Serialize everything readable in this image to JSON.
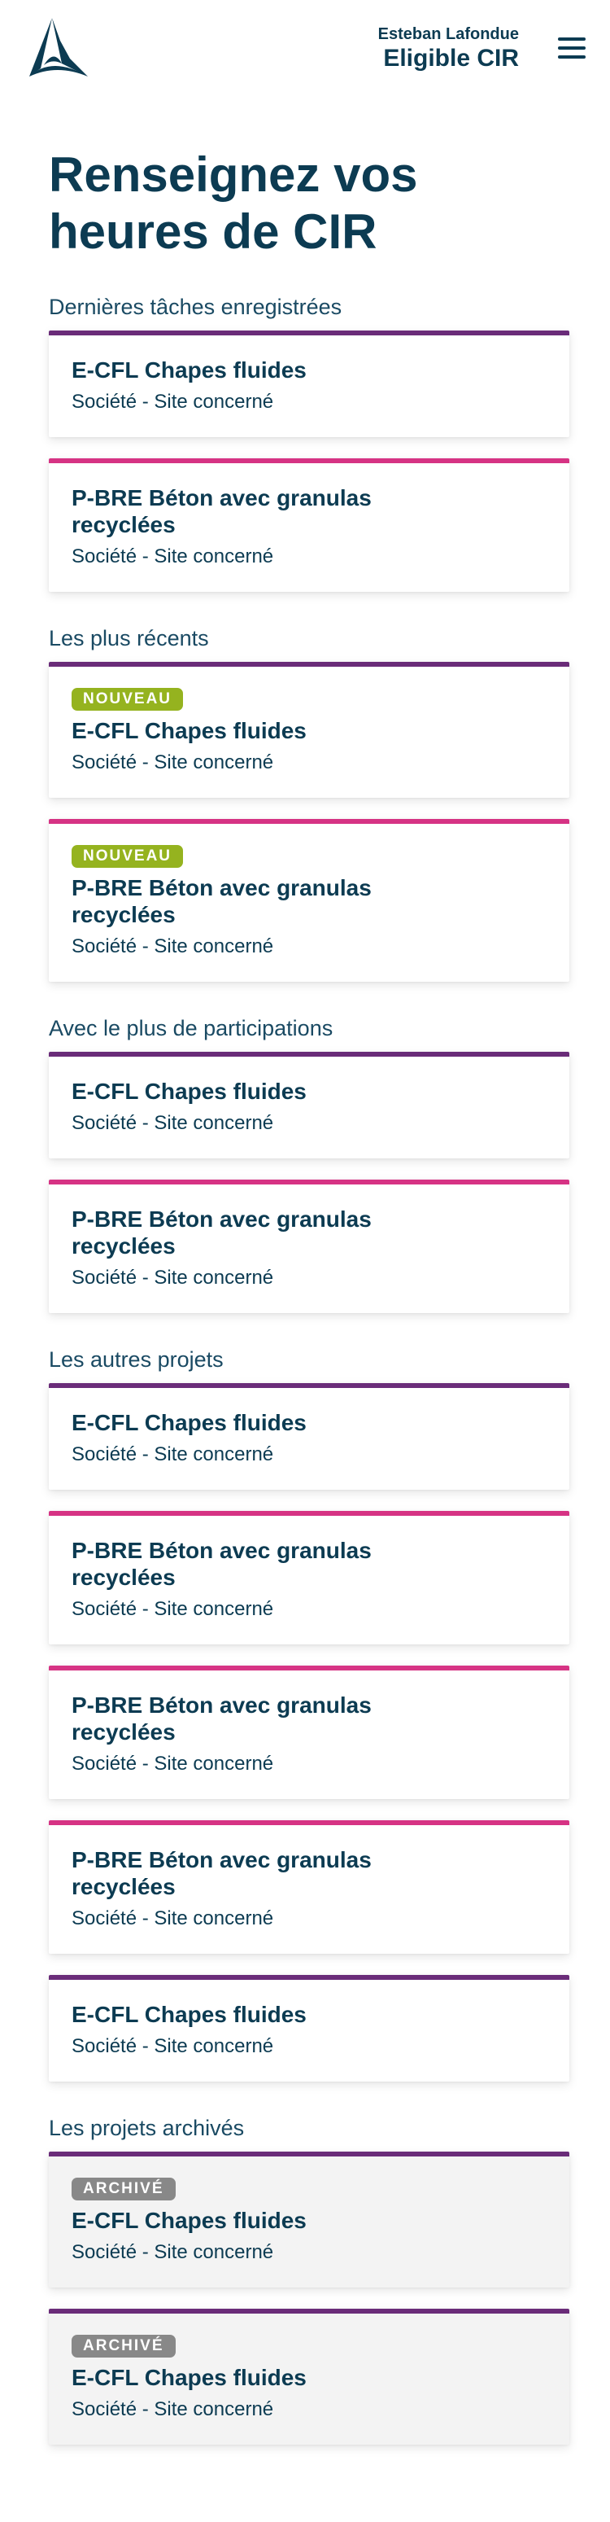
{
  "header": {
    "user_name": "Esteban Lafondue",
    "user_status": "Eligible CIR"
  },
  "page": {
    "title": "Renseignez vos heures de CIR"
  },
  "colors": {
    "primary": "#0c3b52",
    "purple": "#6a2c79",
    "pink": "#d63384",
    "badge_new": "#95b31f",
    "badge_archived": "#888888"
  },
  "sections": [
    {
      "title": "Dernières tâches enregistrées",
      "cards": [
        {
          "accent": "purple",
          "title": "E-CFL Chapes fluides",
          "subtitle": "Société - Site concerné"
        },
        {
          "accent": "pink",
          "title": "P-BRE Béton avec granulas recyclées",
          "subtitle": "Société - Site concerné"
        }
      ]
    },
    {
      "title": "Les plus récents",
      "cards": [
        {
          "accent": "purple",
          "badge": "NOUVEAU",
          "title": "E-CFL Chapes fluides",
          "subtitle": "Société - Site concerné"
        },
        {
          "accent": "pink",
          "badge": "NOUVEAU",
          "title": "P-BRE Béton avec granulas recyclées",
          "subtitle": "Société - Site concerné"
        }
      ]
    },
    {
      "title": "Avec le plus de participations",
      "cards": [
        {
          "accent": "purple",
          "title": "E-CFL Chapes fluides",
          "subtitle": "Société - Site concerné"
        },
        {
          "accent": "pink",
          "title": "P-BRE Béton avec granulas recyclées",
          "subtitle": "Société - Site concerné"
        }
      ]
    },
    {
      "title": "Les autres projets",
      "cards": [
        {
          "accent": "purple",
          "title": "E-CFL Chapes fluides",
          "subtitle": "Société - Site concerné"
        },
        {
          "accent": "pink",
          "title": "P-BRE Béton avec granulas recyclées",
          "subtitle": "Société - Site concerné"
        },
        {
          "accent": "pink",
          "title": "P-BRE Béton avec granulas recyclées",
          "subtitle": "Société - Site concerné"
        },
        {
          "accent": "pink",
          "title": "P-BRE Béton avec granulas recyclées",
          "subtitle": "Société - Site concerné"
        },
        {
          "accent": "purple",
          "title": "E-CFL Chapes fluides",
          "subtitle": "Société - Site concerné"
        }
      ]
    },
    {
      "title": "Les projets archivés",
      "cards": [
        {
          "accent": "purple",
          "badge": "ARCHIVÉ",
          "archived": true,
          "title": "E-CFL Chapes fluides",
          "subtitle": "Société - Site concerné"
        },
        {
          "accent": "purple",
          "badge": "ARCHIVÉ",
          "archived": true,
          "title": "E-CFL Chapes fluides",
          "subtitle": "Société - Site concerné"
        }
      ]
    }
  ]
}
